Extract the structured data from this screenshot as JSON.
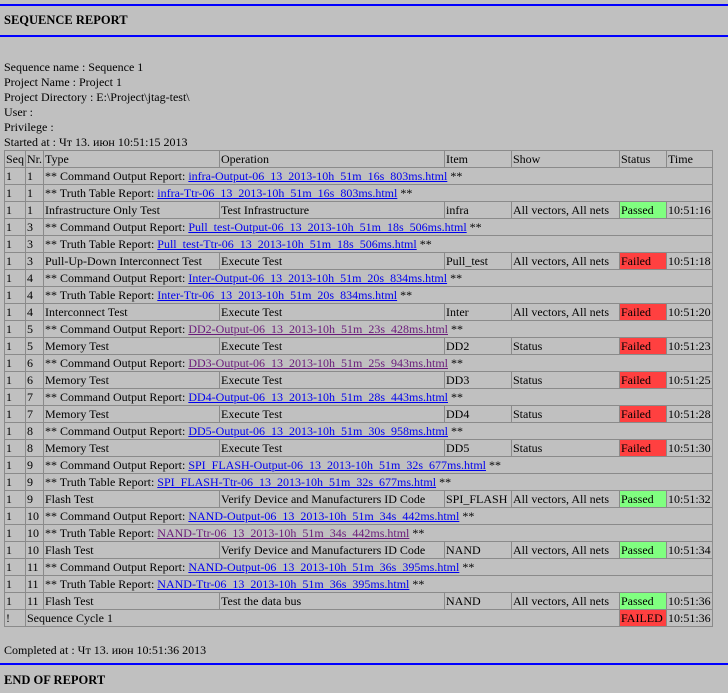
{
  "header": {
    "title": "SEQUENCE REPORT"
  },
  "info": {
    "sequence_name": "Sequence name : Sequence 1",
    "project_name": "Project Name : Project 1",
    "project_directory": "Project Directory : E:\\Project\\jtag-test\\",
    "user": "User :",
    "privilege": "Privilege :",
    "started_at": "Started at : Чт 13. июн 10:51:15 2013"
  },
  "columns": [
    "Seq",
    "Nr.",
    "Type",
    "Operation",
    "Item",
    "Show",
    "Status",
    "Time"
  ],
  "link_prefix": {
    "command": "** Command Output Report: ",
    "truth": "** Truth Table Report: ",
    "suffix": " **"
  },
  "rows": [
    {
      "kind": "link",
      "seq": "1",
      "nr": "1",
      "prefix": "command",
      "link": "infra-Output-06_13_2013-10h_51m_16s_803ms.html",
      "visited": false
    },
    {
      "kind": "link",
      "seq": "1",
      "nr": "1",
      "prefix": "truth",
      "link": "infra-Ttr-06_13_2013-10h_51m_16s_803ms.html",
      "visited": false
    },
    {
      "kind": "test",
      "seq": "1",
      "nr": "1",
      "type": "Infrastructure Only Test",
      "operation": "Test Infrastructure",
      "item": "infra",
      "show": "All vectors, All nets",
      "status": "Passed",
      "time": "10:51:16"
    },
    {
      "kind": "link",
      "seq": "1",
      "nr": "3",
      "prefix": "command",
      "link": "Pull_test-Output-06_13_2013-10h_51m_18s_506ms.html",
      "visited": false
    },
    {
      "kind": "link",
      "seq": "1",
      "nr": "3",
      "prefix": "truth",
      "link": "Pull_test-Ttr-06_13_2013-10h_51m_18s_506ms.html",
      "visited": false
    },
    {
      "kind": "test",
      "seq": "1",
      "nr": "3",
      "type": "Pull-Up-Down Interconnect Test",
      "operation": "Execute Test",
      "item": "Pull_test",
      "show": "All vectors, All nets",
      "status": "Failed",
      "time": "10:51:18"
    },
    {
      "kind": "link",
      "seq": "1",
      "nr": "4",
      "prefix": "command",
      "link": "Inter-Output-06_13_2013-10h_51m_20s_834ms.html",
      "visited": false
    },
    {
      "kind": "link",
      "seq": "1",
      "nr": "4",
      "prefix": "truth",
      "link": "Inter-Ttr-06_13_2013-10h_51m_20s_834ms.html",
      "visited": false
    },
    {
      "kind": "test",
      "seq": "1",
      "nr": "4",
      "type": "Interconnect Test",
      "operation": "Execute Test",
      "item": "Inter",
      "show": "All vectors, All nets",
      "status": "Failed",
      "time": "10:51:20"
    },
    {
      "kind": "link",
      "seq": "1",
      "nr": "5",
      "prefix": "command",
      "link": "DD2-Output-06_13_2013-10h_51m_23s_428ms.html",
      "visited": true
    },
    {
      "kind": "test",
      "seq": "1",
      "nr": "5",
      "type": "Memory Test",
      "operation": "Execute Test",
      "item": "DD2",
      "show": "Status",
      "status": "Failed",
      "time": "10:51:23"
    },
    {
      "kind": "link",
      "seq": "1",
      "nr": "6",
      "prefix": "command",
      "link": "DD3-Output-06_13_2013-10h_51m_25s_943ms.html",
      "visited": true
    },
    {
      "kind": "test",
      "seq": "1",
      "nr": "6",
      "type": "Memory Test",
      "operation": "Execute Test",
      "item": "DD3",
      "show": "Status",
      "status": "Failed",
      "time": "10:51:25"
    },
    {
      "kind": "link",
      "seq": "1",
      "nr": "7",
      "prefix": "command",
      "link": "DD4-Output-06_13_2013-10h_51m_28s_443ms.html",
      "visited": false
    },
    {
      "kind": "test",
      "seq": "1",
      "nr": "7",
      "type": "Memory Test",
      "operation": "Execute Test",
      "item": "DD4",
      "show": "Status",
      "status": "Failed",
      "time": "10:51:28"
    },
    {
      "kind": "link",
      "seq": "1",
      "nr": "8",
      "prefix": "command",
      "link": "DD5-Output-06_13_2013-10h_51m_30s_958ms.html",
      "visited": false
    },
    {
      "kind": "test",
      "seq": "1",
      "nr": "8",
      "type": "Memory Test",
      "operation": "Execute Test",
      "item": "DD5",
      "show": "Status",
      "status": "Failed",
      "time": "10:51:30"
    },
    {
      "kind": "link",
      "seq": "1",
      "nr": "9",
      "prefix": "command",
      "link": "SPI_FLASH-Output-06_13_2013-10h_51m_32s_677ms.html",
      "visited": false
    },
    {
      "kind": "link",
      "seq": "1",
      "nr": "9",
      "prefix": "truth",
      "link": "SPI_FLASH-Ttr-06_13_2013-10h_51m_32s_677ms.html",
      "visited": false
    },
    {
      "kind": "test",
      "seq": "1",
      "nr": "9",
      "type": "Flash Test",
      "operation": "Verify Device and Manufacturers ID Code",
      "item": "SPI_FLASH",
      "show": "All vectors, All nets",
      "status": "Passed",
      "time": "10:51:32"
    },
    {
      "kind": "link",
      "seq": "1",
      "nr": "10",
      "prefix": "command",
      "link": "NAND-Output-06_13_2013-10h_51m_34s_442ms.html",
      "visited": false
    },
    {
      "kind": "link",
      "seq": "1",
      "nr": "10",
      "prefix": "truth",
      "link": "NAND-Ttr-06_13_2013-10h_51m_34s_442ms.html",
      "visited": true
    },
    {
      "kind": "test",
      "seq": "1",
      "nr": "10",
      "type": "Flash Test",
      "operation": "Verify Device and Manufacturers ID Code",
      "item": "NAND",
      "show": "All vectors, All nets",
      "status": "Passed",
      "time": "10:51:34"
    },
    {
      "kind": "link",
      "seq": "1",
      "nr": "11",
      "prefix": "command",
      "link": "NAND-Output-06_13_2013-10h_51m_36s_395ms.html",
      "visited": false
    },
    {
      "kind": "link",
      "seq": "1",
      "nr": "11",
      "prefix": "truth",
      "link": "NAND-Ttr-06_13_2013-10h_51m_36s_395ms.html",
      "visited": false
    },
    {
      "kind": "test",
      "seq": "1",
      "nr": "11",
      "type": "Flash Test",
      "operation": "Test the data bus",
      "item": "NAND",
      "show": "All vectors, All nets",
      "status": "Passed",
      "time": "10:51:36"
    },
    {
      "kind": "summary",
      "seq": "!",
      "label": "Sequence Cycle 1",
      "status": "FAILED",
      "time": "10:51:36"
    }
  ],
  "completed_at": "Completed at : Чт 13. июн 10:51:36 2013",
  "footer": {
    "title": "END OF REPORT"
  },
  "colors": {
    "rule": "#0000ff",
    "passed": "#80ff80",
    "failed": "#ff4040",
    "link": "#0000ee",
    "visited": "#6a1b7a",
    "background": "#c0c0c0"
  }
}
